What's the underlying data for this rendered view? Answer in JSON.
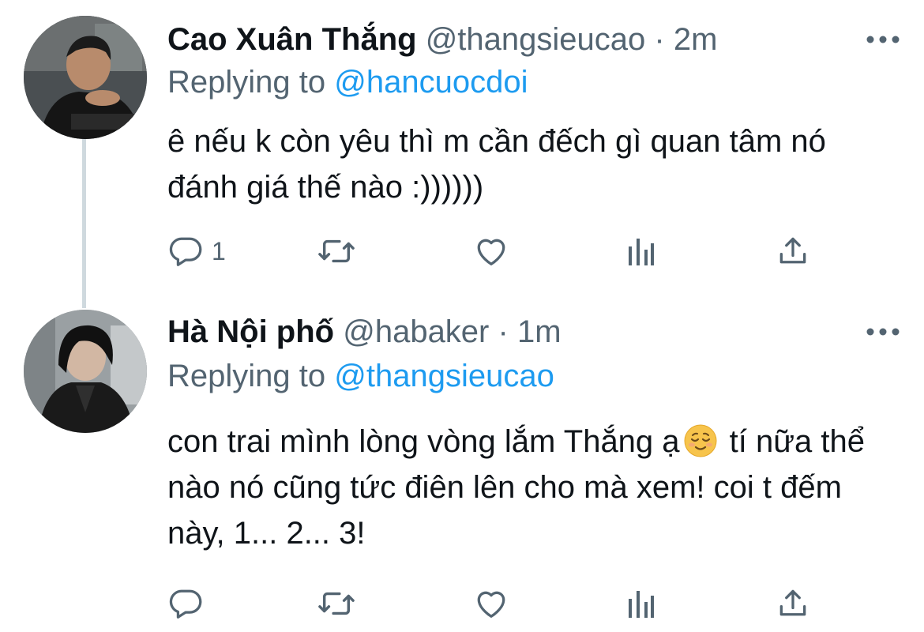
{
  "colors": {
    "text": "#0f1419",
    "secondary": "#536471",
    "link": "#1d9bf0",
    "thread_line": "#cfd9de"
  },
  "tweets": [
    {
      "display_name": "Cao Xuân Thắng",
      "handle": "@thangsieucao",
      "separator": "·",
      "time": "2m",
      "replying_prefix": "Replying to",
      "replying_to": "@hancuocdoi",
      "text": "ê nếu k còn yêu thì m cần đếch gì quan tâm nó đánh giá thế nào :))))))",
      "reply_count": "1",
      "icons": [
        "more-icon",
        "reply-icon",
        "retweet-icon",
        "like-icon",
        "stats-icon",
        "share-icon"
      ]
    },
    {
      "display_name": "Hà Nội phố",
      "handle": "@habaker",
      "separator": "·",
      "time": "1m",
      "replying_prefix": "Replying to",
      "replying_to": "@thangsieucao",
      "text_part1": "con trai mình lòng vòng lắm Thắng ạ",
      "emoji": "relieved-face",
      "text_part2": " tí nữa thể nào nó cũng tức điên lên cho mà xem! coi t đếm này, 1... 2... 3!",
      "reply_count": "",
      "icons": [
        "more-icon",
        "reply-icon",
        "retweet-icon",
        "like-icon",
        "stats-icon",
        "share-icon"
      ]
    }
  ]
}
